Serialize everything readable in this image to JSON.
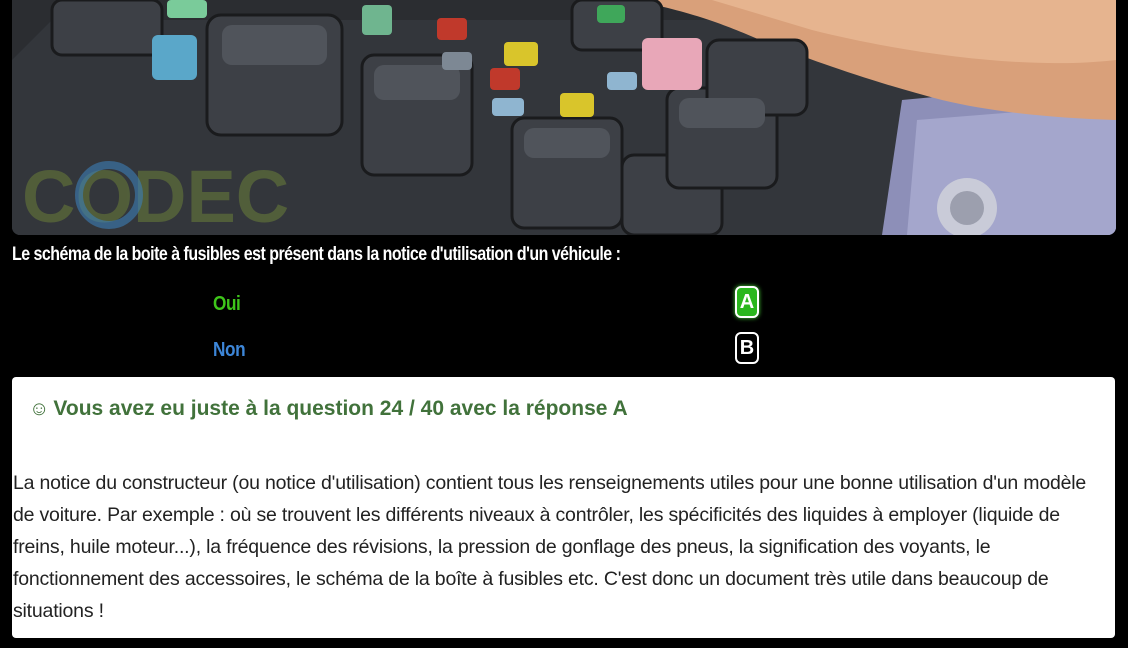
{
  "photo": {
    "alt": "Boîte à fusibles",
    "watermark": "CODEC"
  },
  "question": {
    "text": "Le schéma de la boite à fusibles est présent dans la notice d'utilisation d'un véhicule :"
  },
  "answers": [
    {
      "label": "Oui",
      "letter": "A",
      "status": "correct",
      "color": "#3ec51a"
    },
    {
      "label": "Non",
      "letter": "B",
      "status": "neutral",
      "color": "#3d86d8"
    }
  ],
  "result": {
    "icon": "smile-icon",
    "title": "Vous avez eu juste à la question 24 / 40 avec la réponse A",
    "explanation": "La notice du constructeur (ou notice d'utilisation) contient tous les renseignements utiles pour une bonne utilisation d'un modèle de voiture. Par exemple : où se trouvent les différents niveaux à contrôler, les spécificités des liquides à employer (liquide de freins, huile moteur...), la fréquence des révisions, la pression de gonflage des pneus, la signification des voyants, le fonctionnement des accessoires, le schéma de la boîte à fusibles etc. C'est donc un document très utile dans beaucoup de situations !"
  },
  "colors": {
    "background": "#000000",
    "correct_green": "#2ab71d",
    "title_green": "#41723b",
    "blue": "#3d86d8"
  }
}
